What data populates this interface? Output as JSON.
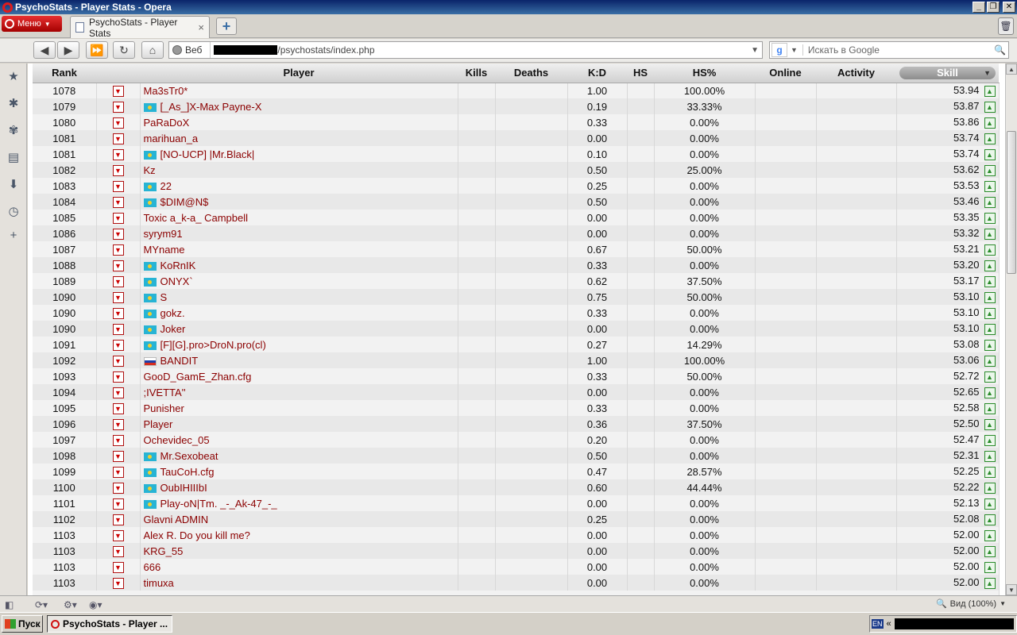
{
  "window": {
    "title": "PsychoStats - Player Stats - Opera"
  },
  "tabbar": {
    "menu_label": "Меню",
    "tab_title": "PsychoStats - Player Stats",
    "tab_close": "×",
    "new_tab": "+"
  },
  "toolbar": {
    "web_label": "Веб",
    "url_text": "/psychostats/index.php",
    "search_placeholder": "Искать в Google",
    "search_engine_letter": "g"
  },
  "table": {
    "headers": [
      "Rank",
      "",
      "Player",
      "Kills",
      "Deaths",
      "K:D",
      "HS",
      "HS%",
      "Online",
      "Activity",
      "Skill"
    ],
    "rows": [
      {
        "rank": "1078",
        "flag": "",
        "player": "Ma3sTr0*",
        "kd": "1.00",
        "hsp": "100.00%",
        "skill": "53.94"
      },
      {
        "rank": "1079",
        "flag": "kz",
        "player": "[_As_]X-Max Payne-X",
        "kd": "0.19",
        "hsp": "33.33%",
        "skill": "53.87"
      },
      {
        "rank": "1080",
        "flag": "",
        "player": "PaRaDoX",
        "kd": "0.33",
        "hsp": "0.00%",
        "skill": "53.86"
      },
      {
        "rank": "1081",
        "flag": "",
        "player": "marihuan_a",
        "kd": "0.00",
        "hsp": "0.00%",
        "skill": "53.74"
      },
      {
        "rank": "1081",
        "flag": "kz",
        "player": "[NO-UCP] |Mr.Black|",
        "kd": "0.10",
        "hsp": "0.00%",
        "skill": "53.74"
      },
      {
        "rank": "1082",
        "flag": "",
        "player": "Kz",
        "kd": "0.50",
        "hsp": "25.00%",
        "skill": "53.62"
      },
      {
        "rank": "1083",
        "flag": "kz",
        "player": "22",
        "kd": "0.25",
        "hsp": "0.00%",
        "skill": "53.53"
      },
      {
        "rank": "1084",
        "flag": "kz",
        "player": "$DIM@N$",
        "kd": "0.50",
        "hsp": "0.00%",
        "skill": "53.46"
      },
      {
        "rank": "1085",
        "flag": "",
        "player": "Toxic a_k-a_ Campbell",
        "kd": "0.00",
        "hsp": "0.00%",
        "skill": "53.35"
      },
      {
        "rank": "1086",
        "flag": "",
        "player": "syrym91",
        "kd": "0.00",
        "hsp": "0.00%",
        "skill": "53.32"
      },
      {
        "rank": "1087",
        "flag": "",
        "player": "MYname",
        "kd": "0.67",
        "hsp": "50.00%",
        "skill": "53.21"
      },
      {
        "rank": "1088",
        "flag": "kz",
        "player": "KoRnIK",
        "kd": "0.33",
        "hsp": "0.00%",
        "skill": "53.20"
      },
      {
        "rank": "1089",
        "flag": "kz",
        "player": "ONYX`",
        "kd": "0.62",
        "hsp": "37.50%",
        "skill": "53.17"
      },
      {
        "rank": "1090",
        "flag": "kz",
        "player": "S",
        "kd": "0.75",
        "hsp": "50.00%",
        "skill": "53.10"
      },
      {
        "rank": "1090",
        "flag": "kz",
        "player": "gokz.",
        "kd": "0.33",
        "hsp": "0.00%",
        "skill": "53.10"
      },
      {
        "rank": "1090",
        "flag": "kz",
        "player": "Joker",
        "kd": "0.00",
        "hsp": "0.00%",
        "skill": "53.10"
      },
      {
        "rank": "1091",
        "flag": "kz",
        "player": "[F][G].pro>DroN.pro(cl)",
        "kd": "0.27",
        "hsp": "14.29%",
        "skill": "53.08"
      },
      {
        "rank": "1092",
        "flag": "ru",
        "player": "BANDIT",
        "kd": "1.00",
        "hsp": "100.00%",
        "skill": "53.06"
      },
      {
        "rank": "1093",
        "flag": "",
        "player": "GooD_GamE_Zhan.cfg",
        "kd": "0.33",
        "hsp": "50.00%",
        "skill": "52.72"
      },
      {
        "rank": "1094",
        "flag": "",
        "player": ";IVETTA''",
        "kd": "0.00",
        "hsp": "0.00%",
        "skill": "52.65"
      },
      {
        "rank": "1095",
        "flag": "",
        "player": "Punisher",
        "kd": "0.33",
        "hsp": "0.00%",
        "skill": "52.58"
      },
      {
        "rank": "1096",
        "flag": "",
        "player": "Player",
        "kd": "0.36",
        "hsp": "37.50%",
        "skill": "52.50"
      },
      {
        "rank": "1097",
        "flag": "",
        "player": "Ochevidec_05",
        "kd": "0.20",
        "hsp": "0.00%",
        "skill": "52.47"
      },
      {
        "rank": "1098",
        "flag": "kz",
        "player": "Mr.Sexobeat",
        "kd": "0.50",
        "hsp": "0.00%",
        "skill": "52.31"
      },
      {
        "rank": "1099",
        "flag": "kz",
        "player": "TauCoH.cfg",
        "kd": "0.47",
        "hsp": "28.57%",
        "skill": "52.25"
      },
      {
        "rank": "1100",
        "flag": "kz",
        "player": "OubIHIIIbI",
        "kd": "0.60",
        "hsp": "44.44%",
        "skill": "52.22"
      },
      {
        "rank": "1101",
        "flag": "kz",
        "player": "Play-oN|Tm. _-_Ak-47_-_",
        "kd": "0.00",
        "hsp": "0.00%",
        "skill": "52.13"
      },
      {
        "rank": "1102",
        "flag": "",
        "player": "Glavni ADMIN",
        "kd": "0.25",
        "hsp": "0.00%",
        "skill": "52.08"
      },
      {
        "rank": "1103",
        "flag": "",
        "player": "Alex R. Do you kill me?",
        "kd": "0.00",
        "hsp": "0.00%",
        "skill": "52.00"
      },
      {
        "rank": "1103",
        "flag": "",
        "player": "KRG_55",
        "kd": "0.00",
        "hsp": "0.00%",
        "skill": "52.00"
      },
      {
        "rank": "1103",
        "flag": "",
        "player": "666",
        "kd": "0.00",
        "hsp": "0.00%",
        "skill": "52.00"
      },
      {
        "rank": "1103",
        "flag": "",
        "player": "timuxa",
        "kd": "0.00",
        "hsp": "0.00%",
        "skill": "52.00"
      }
    ]
  },
  "statusbar": {
    "zoom_label": "Вид (100%)"
  },
  "taskbar": {
    "start_label": "Пуск",
    "task_label": "PsychoStats - Player ...",
    "lang": "EN",
    "tray_arrow": "«"
  },
  "colors": {
    "player_link": "#8b0000",
    "title_bar": "#0a246a",
    "opera_red": "#cc0f16"
  }
}
